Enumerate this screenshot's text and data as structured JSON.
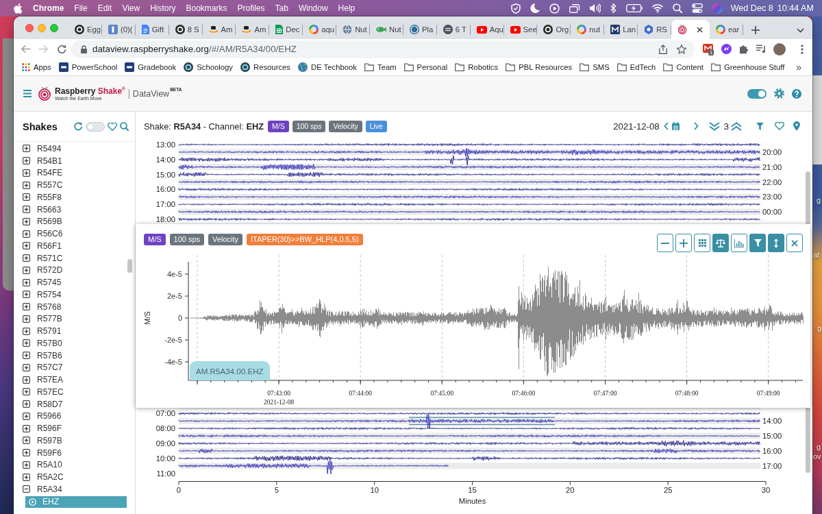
{
  "menu_bar": {
    "app": "Chrome",
    "items": [
      "File",
      "Edit",
      "View",
      "History",
      "Bookmarks",
      "Profiles",
      "Tab",
      "Window",
      "Help"
    ],
    "date": "Wed Dec 8",
    "time": "10:44 AM"
  },
  "desktop": {
    "label_fragments": [
      "g",
      "at",
      "g",
      "g",
      "ov"
    ]
  },
  "browser": {
    "tabs": [
      {
        "title": "Egg",
        "selected": false
      },
      {
        "title": "(0)(",
        "selected": false
      },
      {
        "title": "Gift",
        "selected": false
      },
      {
        "title": "8 S",
        "selected": false
      },
      {
        "title": "Am",
        "selected": false
      },
      {
        "title": "Am",
        "selected": false
      },
      {
        "title": "Dec",
        "selected": false
      },
      {
        "title": "aqu",
        "selected": false
      },
      {
        "title": "Nut",
        "selected": false
      },
      {
        "title": "Nut",
        "selected": false
      },
      {
        "title": "Pla",
        "selected": false
      },
      {
        "title": "6 T",
        "selected": false
      },
      {
        "title": "Aqu",
        "selected": false
      },
      {
        "title": "See",
        "selected": false
      },
      {
        "title": "Org",
        "selected": false
      },
      {
        "title": "nut",
        "selected": false
      },
      {
        "title": "Lan",
        "selected": false
      },
      {
        "title": "RS",
        "selected": false
      },
      {
        "selected": true
      },
      {
        "title": "ear",
        "selected": false
      }
    ],
    "address": {
      "domain": "dataview.raspberryshake.org",
      "path": "/#/AM/R5A34/00/EHZ"
    },
    "extension_badge": "1",
    "bookmarks": [
      "Apps",
      "PowerSchool",
      "Gradebook",
      "Schoology",
      "Resources",
      "DE Techbook",
      "Team",
      "Personal",
      "Robotics",
      "PBL Resources",
      "SMS",
      "EdTech",
      "Content",
      "Greenhouse Stuff"
    ],
    "bookmarks_more": "»"
  },
  "app": {
    "header": {
      "brand": "Raspberry",
      "brand_accent": "Shake$^{®}$",
      "tagline": "Watch the Earth Move",
      "product": "DataView",
      "product_tag": "BETA",
      "toggle": {
        "on": true
      }
    },
    "sidebar": {
      "title": "Shakes",
      "toggle": {
        "on": false
      },
      "stations": [
        {
          "label": "R5494",
          "expanded": false,
          "selected": false
        },
        {
          "label": "R54B1",
          "expanded": false,
          "selected": false
        },
        {
          "label": "R54FE",
          "expanded": false,
          "selected": false
        },
        {
          "label": "R557C",
          "expanded": false,
          "selected": false
        },
        {
          "label": "R55F8",
          "expanded": false,
          "selected": false
        },
        {
          "label": "R5663",
          "expanded": false,
          "selected": false
        },
        {
          "label": "R569B",
          "expanded": false,
          "selected": false
        },
        {
          "label": "R56C6",
          "expanded": false,
          "selected": false
        },
        {
          "label": "R56F1",
          "expanded": false,
          "selected": false
        },
        {
          "label": "R571C",
          "expanded": false,
          "selected": false
        },
        {
          "label": "R572D",
          "expanded": false,
          "selected": false
        },
        {
          "label": "R5745",
          "expanded": false,
          "selected": false
        },
        {
          "label": "R5754",
          "expanded": false,
          "selected": false
        },
        {
          "label": "R5768",
          "expanded": false,
          "selected": false
        },
        {
          "label": "R577B",
          "expanded": false,
          "selected": false
        },
        {
          "label": "R5791",
          "expanded": false,
          "selected": false
        },
        {
          "label": "R57B0",
          "expanded": false,
          "selected": false
        },
        {
          "label": "R57B6",
          "expanded": false,
          "selected": false
        },
        {
          "label": "R57C7",
          "expanded": false,
          "selected": false
        },
        {
          "label": "R57EA",
          "expanded": false,
          "selected": false
        },
        {
          "label": "R57EC",
          "expanded": false,
          "selected": false
        },
        {
          "label": "R58D7",
          "expanded": false,
          "selected": false
        },
        {
          "label": "R5966",
          "expanded": false,
          "selected": false
        },
        {
          "label": "R596F",
          "expanded": false,
          "selected": false
        },
        {
          "label": "R597B",
          "expanded": false,
          "selected": false
        },
        {
          "label": "R59F6",
          "expanded": false,
          "selected": false
        },
        {
          "label": "R5A10",
          "expanded": false,
          "selected": false
        },
        {
          "label": "R5A2C",
          "expanded": false,
          "selected": false
        },
        {
          "label": "R5A34",
          "expanded": true,
          "selected": false,
          "children": [
            {
              "label": "EHZ",
              "selected": true
            }
          ]
        }
      ]
    },
    "toolbar": {
      "title": "Shake: **R5A34** - Channel: **EHZ**",
      "badges": [
        {
          "text": "M/S",
          "color": "#6f42c1"
        },
        {
          "text": "100 sps",
          "color": "#6c757d"
        },
        {
          "text": "Velocity",
          "color": "#6c757d"
        },
        {
          "text": "Live",
          "color": "#4a8fdb"
        }
      ],
      "date": "2021-12-08",
      "hours": "3"
    },
    "helicorder": {
      "upper": {
        "left_labels": [
          "13:00",
          "14:00",
          "15:00",
          "16:00",
          "17:00",
          "18:00"
        ],
        "right_labels": [
          "20:00",
          "21:00",
          "22:00",
          "23:00",
          "00:00"
        ]
      },
      "lower": {
        "left_labels": [
          "07:00",
          "08:00",
          "09:00",
          "10:00",
          "11:00"
        ],
        "right_labels": [
          "14:00",
          "15:00",
          "16:00",
          "17:00"
        ]
      },
      "x_ticks": [
        "0",
        "5",
        "10",
        "15",
        "20",
        "25",
        "30"
      ],
      "xlabel": "Minutes"
    },
    "detail": {
      "badges": [
        {
          "text": "M/S",
          "color": "#6f42c1"
        },
        {
          "text": "100 sps",
          "color": "#6c757d"
        },
        {
          "text": "Velocity",
          "color": "#6c757d"
        },
        {
          "text": "ITAPER(30)>>BW_HLP(4,0.5,5)",
          "color": "#f07f3c"
        }
      ],
      "tools": [
        {
          "on": false
        },
        {
          "on": false
        },
        {
          "on": false
        },
        {
          "on": true
        },
        {
          "on": false
        },
        {
          "on": true
        },
        {
          "on": true
        },
        {
          "on": false
        }
      ],
      "ylabel": "M/S",
      "y_ticks": [
        "4e-5",
        "2e-5",
        "0",
        "-2e-5",
        "-4e-5"
      ],
      "x_ticks": [
        "07:43:00",
        "07:44:00",
        "07:45:00",
        "07:46:00",
        "07:47:00",
        "07:48:00",
        "07:49:00"
      ],
      "date": "2021-12-08",
      "trace_label": "AM.R5A34.00.EHZ"
    }
  }
}
